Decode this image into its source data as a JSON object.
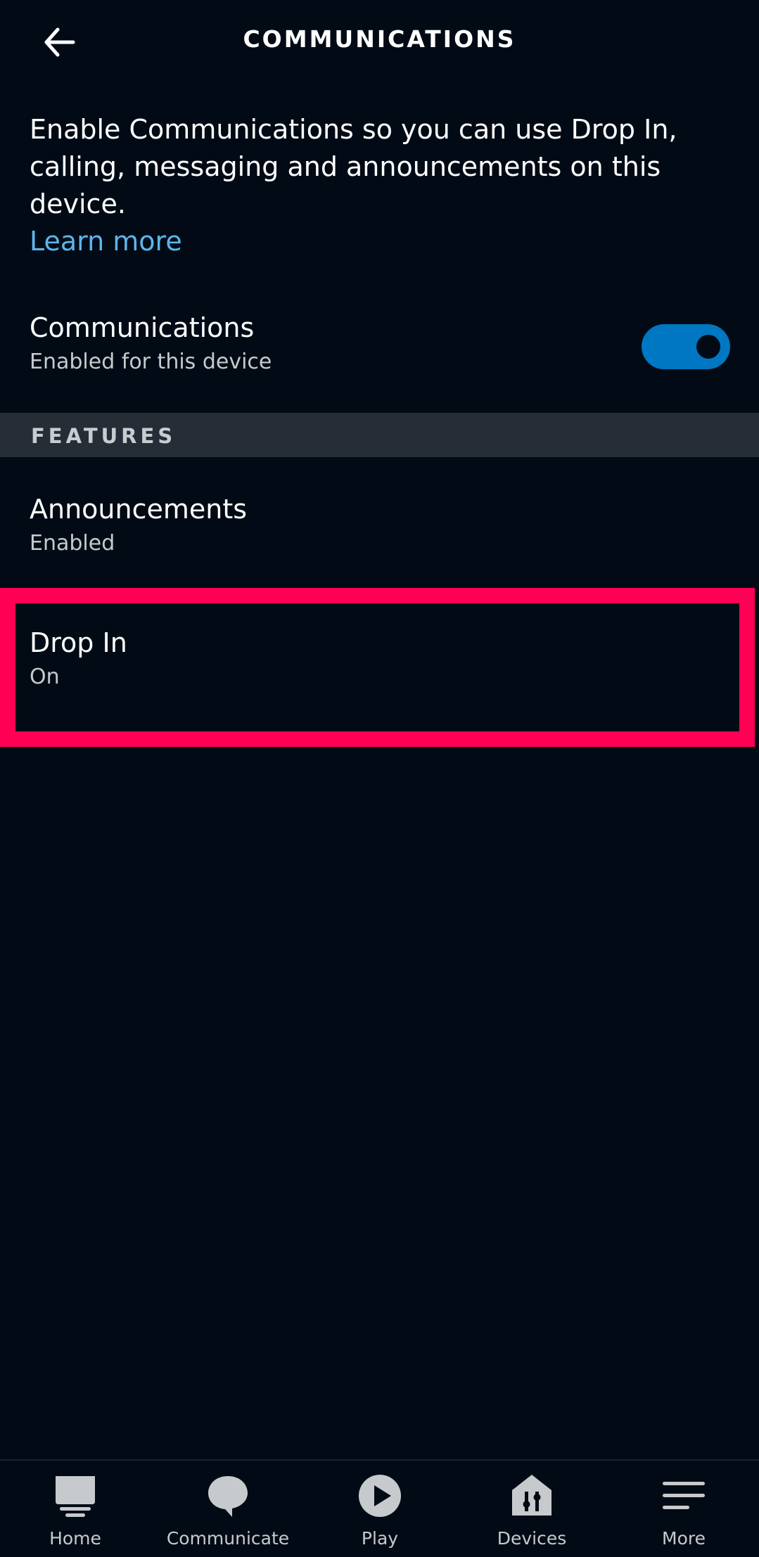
{
  "header": {
    "title": "COMMUNICATIONS",
    "back_icon": "arrow-left-icon"
  },
  "intro": {
    "text": "Enable Communications so you can use Drop In, calling, messaging and announcements on this device.",
    "link": "Learn more"
  },
  "communications": {
    "title": "Communications",
    "subtitle": "Enabled for this device",
    "toggle_on": true
  },
  "features": {
    "section_label": "FEATURES",
    "items": [
      {
        "title": "Announcements",
        "status": "Enabled"
      },
      {
        "title": "Drop In",
        "status": "On"
      }
    ]
  },
  "nav": {
    "items": [
      {
        "label": "Home",
        "icon": "home-icon"
      },
      {
        "label": "Communicate",
        "icon": "chat-bubble-icon"
      },
      {
        "label": "Play",
        "icon": "play-icon"
      },
      {
        "label": "Devices",
        "icon": "devices-icon"
      },
      {
        "label": "More",
        "icon": "menu-icon"
      }
    ]
  },
  "colors": {
    "background": "#020b15",
    "accent": "#0077c2",
    "link": "#5cb5ec",
    "highlight": "#ff0055",
    "section_bg": "#262d37"
  }
}
